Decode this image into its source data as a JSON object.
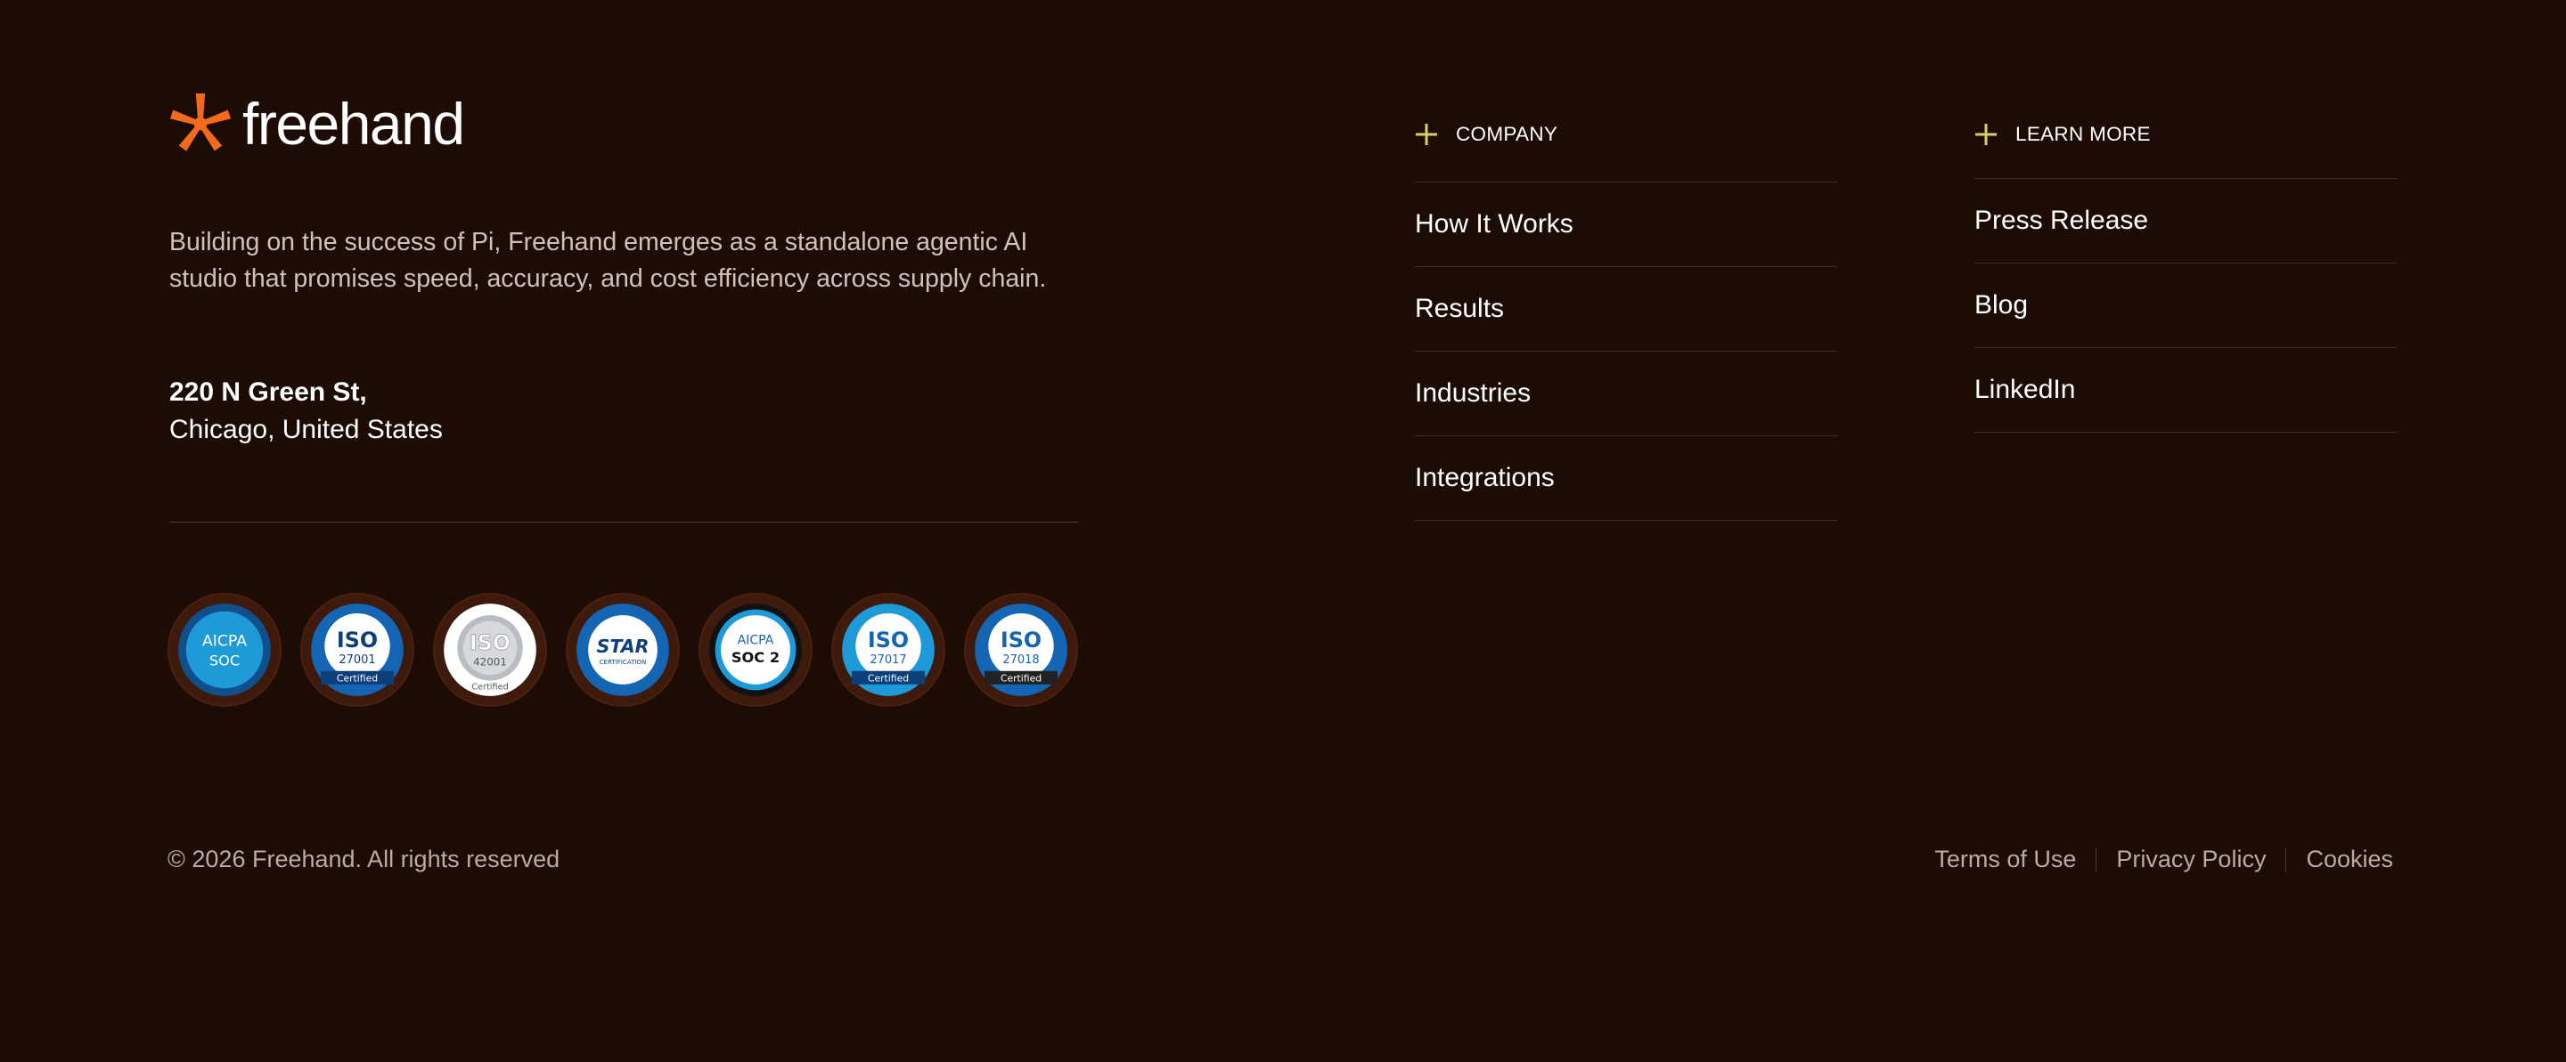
{
  "brand": {
    "name": "freehand",
    "accent": "#f26a1b"
  },
  "intro": {
    "tagline": "Building on the success of Pi, Freehand emerges as a standalone agentic AI studio that promises speed, accuracy, and cost efficiency across supply chain."
  },
  "address": {
    "line1": "220 N Green St,",
    "line2": "Chicago, United States"
  },
  "badges": [
    {
      "icon": "aicpa-soc-badge-icon",
      "top": "AICPA",
      "bottom": "SOC"
    },
    {
      "icon": "iso-27001-badge-icon",
      "top": "ISO",
      "num": "27001",
      "bottom": "Certified"
    },
    {
      "icon": "iso-42001-badge-icon",
      "top": "ISO",
      "num": "42001",
      "bottom": "Certified"
    },
    {
      "icon": "star-certification-badge-icon",
      "top": "STAR",
      "bottom": "CERTIFICATION"
    },
    {
      "icon": "aicpa-soc2-badge-icon",
      "top": "AICPA",
      "bottom": "SOC 2"
    },
    {
      "icon": "iso-27017-badge-icon",
      "top": "ISO",
      "num": "27017",
      "bottom": "Certified"
    },
    {
      "icon": "iso-27018-badge-icon",
      "top": "ISO",
      "num": "27018",
      "bottom": "Certified"
    }
  ],
  "company": {
    "heading": "COMPANY",
    "links": [
      "How It Works",
      "Results",
      "Industries",
      "Integrations"
    ]
  },
  "learn_more": {
    "heading": "LEARN MORE",
    "links": [
      "Press Release",
      "Blog",
      "LinkedIn"
    ]
  },
  "footer": {
    "copyright": "© 2026 Freehand. All rights reserved",
    "legal": [
      "Terms of Use",
      "Privacy Policy",
      "Cookies"
    ]
  },
  "colors": {
    "background": "#1c0c04",
    "plus": "#d8d266",
    "badge_blue": "#1565b5"
  }
}
